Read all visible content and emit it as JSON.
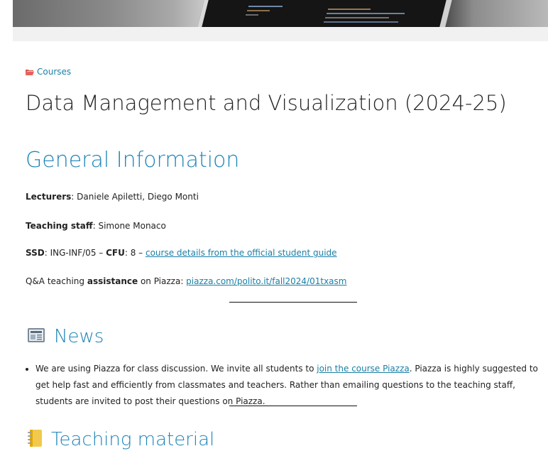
{
  "breadcrumb": {
    "label": "Courses"
  },
  "course": {
    "title": "Data Management and Visualization (2024-25)"
  },
  "general": {
    "heading": "General Information",
    "lecturers_label": "Lecturers",
    "lecturers_value": ": Daniele Apiletti, Diego Monti",
    "staff_label": "Teaching staff",
    "staff_value": ": Simone Monaco",
    "ssd_label": "SSD",
    "ssd_value": ": ING-INF/05 – ",
    "cfu_label": "CFU",
    "cfu_value": ": 8 – ",
    "guide_link": "course details from the official student guide",
    "qa_prefix": "Q&A teaching ",
    "qa_bold": "assistance",
    "qa_middle": " on Piazza: ",
    "qa_link": "piazza.com/polito.it/fall2024/01txasm"
  },
  "news": {
    "heading": "News",
    "item_before_link": "We are using Piazza for class discussion. We invite all students to ",
    "item_link": "join the course Piazza",
    "item_after_link": ". Piazza is highly suggested to get help fast and efficiently from classmates and teachers. Rather than emailing questions to the teaching staff, students are invited to post their questions on Piazza."
  },
  "teaching": {
    "heading": "Teaching material"
  },
  "colors": {
    "accent": "#1f85b8",
    "link": "#1a7fa6",
    "text": "#222222"
  },
  "icons": {
    "breadcrumb": "folder-icon",
    "news": "newspaper-icon",
    "teaching": "notebook-icon"
  }
}
